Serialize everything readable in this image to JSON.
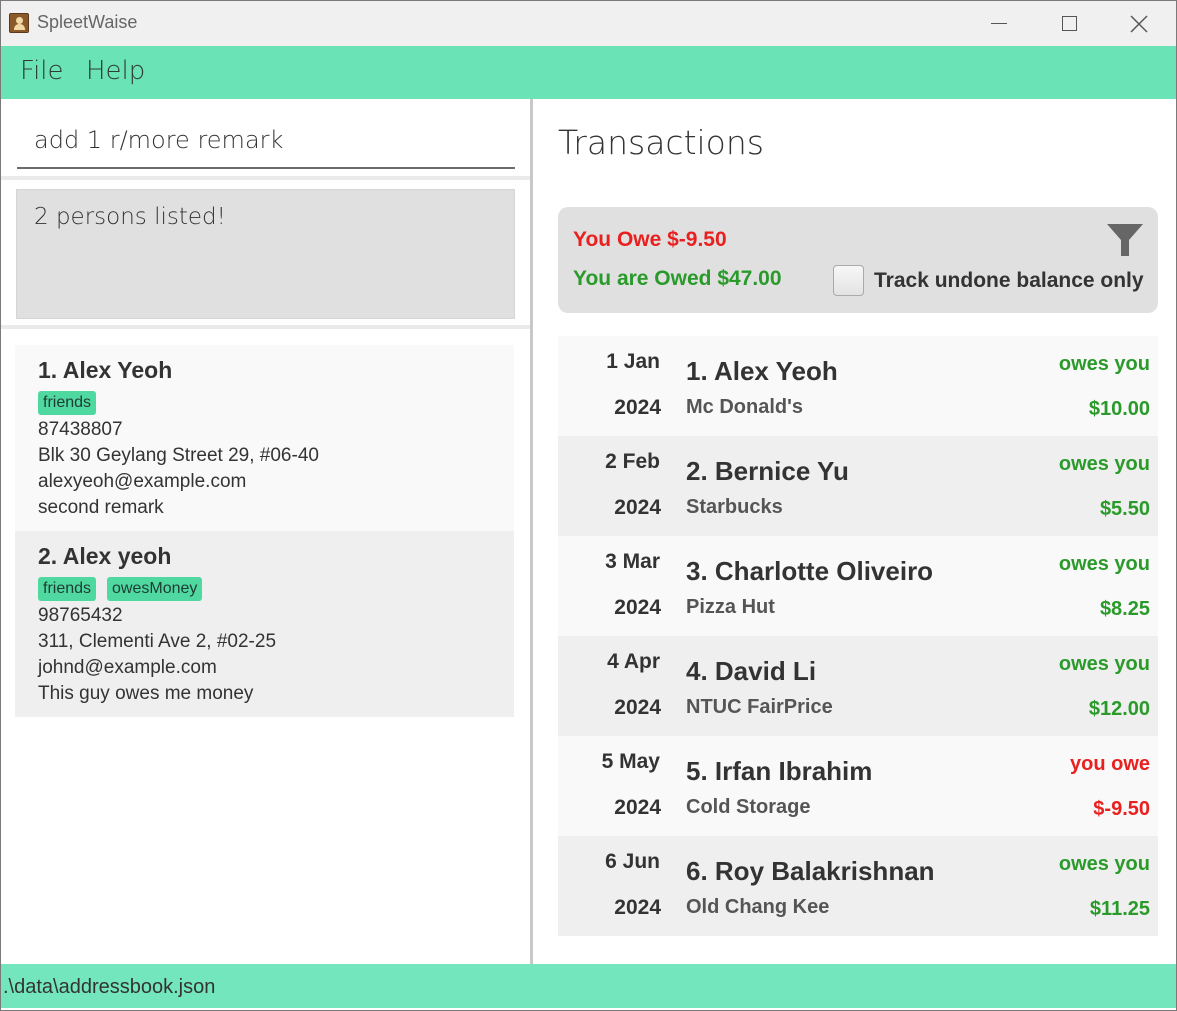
{
  "window": {
    "title": "SpleetWaise"
  },
  "menu": {
    "file": "File",
    "help": "Help"
  },
  "command": {
    "value": "add 1 r/more remark"
  },
  "result": {
    "text": "2 persons listed!"
  },
  "persons": [
    {
      "name": "1. Alex Yeoh",
      "tags": [
        "friends"
      ],
      "phone": "87438807",
      "address": "Blk 30 Geylang Street 29, #06-40",
      "email": "alexyeoh@example.com",
      "remark": "second remark"
    },
    {
      "name": "2. Alex yeoh",
      "tags": [
        "friends",
        "owesMoney"
      ],
      "phone": "98765432",
      "address": "311, Clementi Ave 2, #02-25",
      "email": "johnd@example.com",
      "remark": "This guy owes me money"
    }
  ],
  "transactions": {
    "title": "Transactions",
    "you_owe": "You Owe $-9.50",
    "you_are_owed": "You are Owed $47.00",
    "track_label": "Track undone balance only",
    "track_checked": false,
    "items": [
      {
        "day": "1 Jan",
        "year": "2024",
        "name": "1. Alex Yeoh",
        "desc": "Mc Donald's",
        "status": "owes you",
        "amount": "$10.00",
        "color": "#2a9a2a"
      },
      {
        "day": "2 Feb",
        "year": "2024",
        "name": "2. Bernice Yu",
        "desc": "Starbucks",
        "status": "owes you",
        "amount": "$5.50",
        "color": "#2a9a2a"
      },
      {
        "day": "3 Mar",
        "year": "2024",
        "name": "3. Charlotte Oliveiro",
        "desc": "Pizza Hut",
        "status": "owes you",
        "amount": "$8.25",
        "color": "#2a9a2a"
      },
      {
        "day": "4 Apr",
        "year": "2024",
        "name": "4. David Li",
        "desc": "NTUC FairPrice",
        "status": "owes you",
        "amount": "$12.00",
        "color": "#2a9a2a"
      },
      {
        "day": "5 May",
        "year": "2024",
        "name": "5. Irfan Ibrahim",
        "desc": "Cold Storage",
        "status": "you owe",
        "amount": "$-9.50",
        "color": "#e8201f"
      },
      {
        "day": "6 Jun",
        "year": "2024",
        "name": "6. Roy Balakrishnan",
        "desc": "Old Chang Kee",
        "status": "owes you",
        "amount": "$11.25",
        "color": "#2a9a2a"
      }
    ]
  },
  "status": {
    "path": ".\\data\\addressbook.json"
  },
  "colors": {
    "accent": "#6ae3b6",
    "tag": "#4fd8a0",
    "positive": "#2a9a2a",
    "negative": "#e8201f"
  }
}
